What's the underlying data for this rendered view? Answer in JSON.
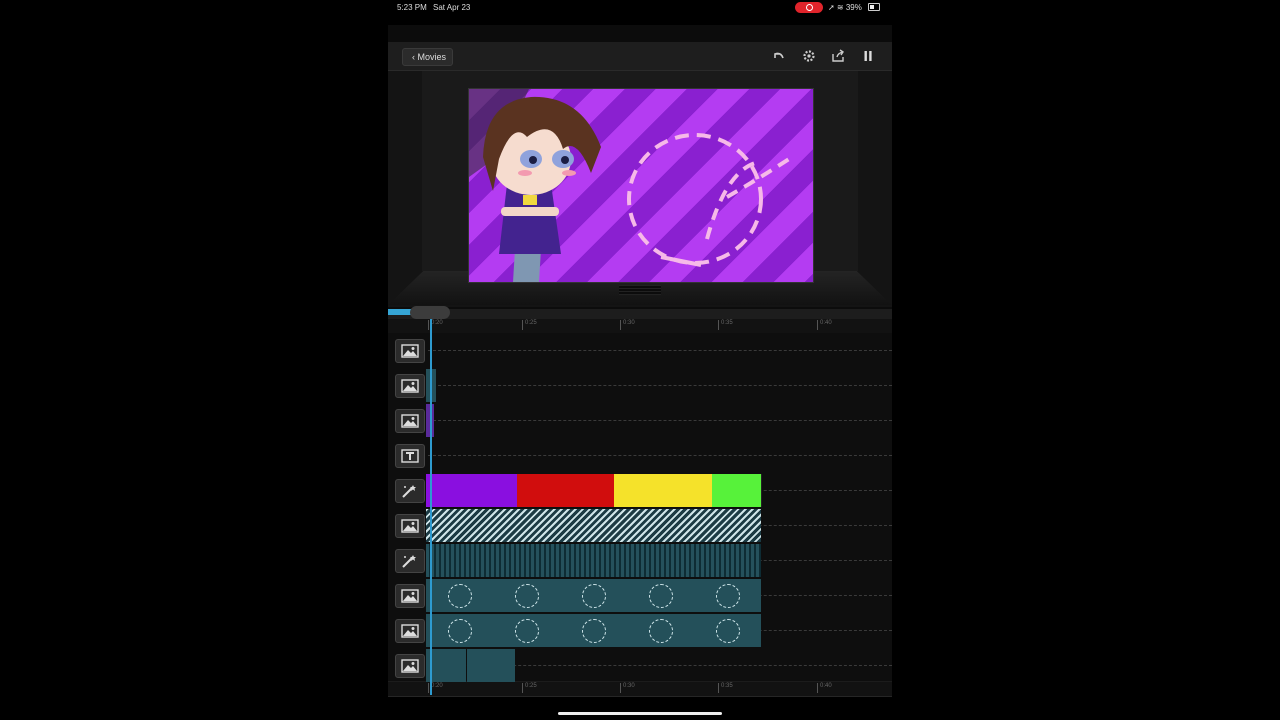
{
  "status_bar": {
    "time": "5:23 PM",
    "date": "Sat Apr 23",
    "battery": "39%",
    "recording_color": "#e0242b"
  },
  "toolbar": {
    "back_label": "Movies",
    "icons": [
      "undo-icon",
      "gear-icon",
      "share-icon",
      "pause-icon"
    ]
  },
  "preview": {
    "background_colors": [
      "#b43cf2",
      "#8a20d0"
    ],
    "accent_color": "#f6b9e8"
  },
  "timeline": {
    "playhead_color": "#2e9bd0",
    "ruler_ticks": [
      "0:20",
      "0:25",
      "0:30",
      "0:35",
      "0:40"
    ],
    "tracks": [
      {
        "type": "image",
        "icon": "image-icon"
      },
      {
        "type": "image",
        "icon": "image-icon"
      },
      {
        "type": "image",
        "icon": "image-icon"
      },
      {
        "type": "text",
        "icon": "text-icon"
      },
      {
        "type": "effect",
        "icon": "effects-icon",
        "segments": [
          "#8a0fe0",
          "#d10d0d",
          "#f5e22a",
          "#57f23a"
        ]
      },
      {
        "type": "image",
        "icon": "image-icon"
      },
      {
        "type": "effect",
        "icon": "effects-icon"
      },
      {
        "type": "image",
        "icon": "image-icon"
      },
      {
        "type": "image",
        "icon": "image-icon"
      },
      {
        "type": "image",
        "icon": "image-icon"
      }
    ]
  }
}
